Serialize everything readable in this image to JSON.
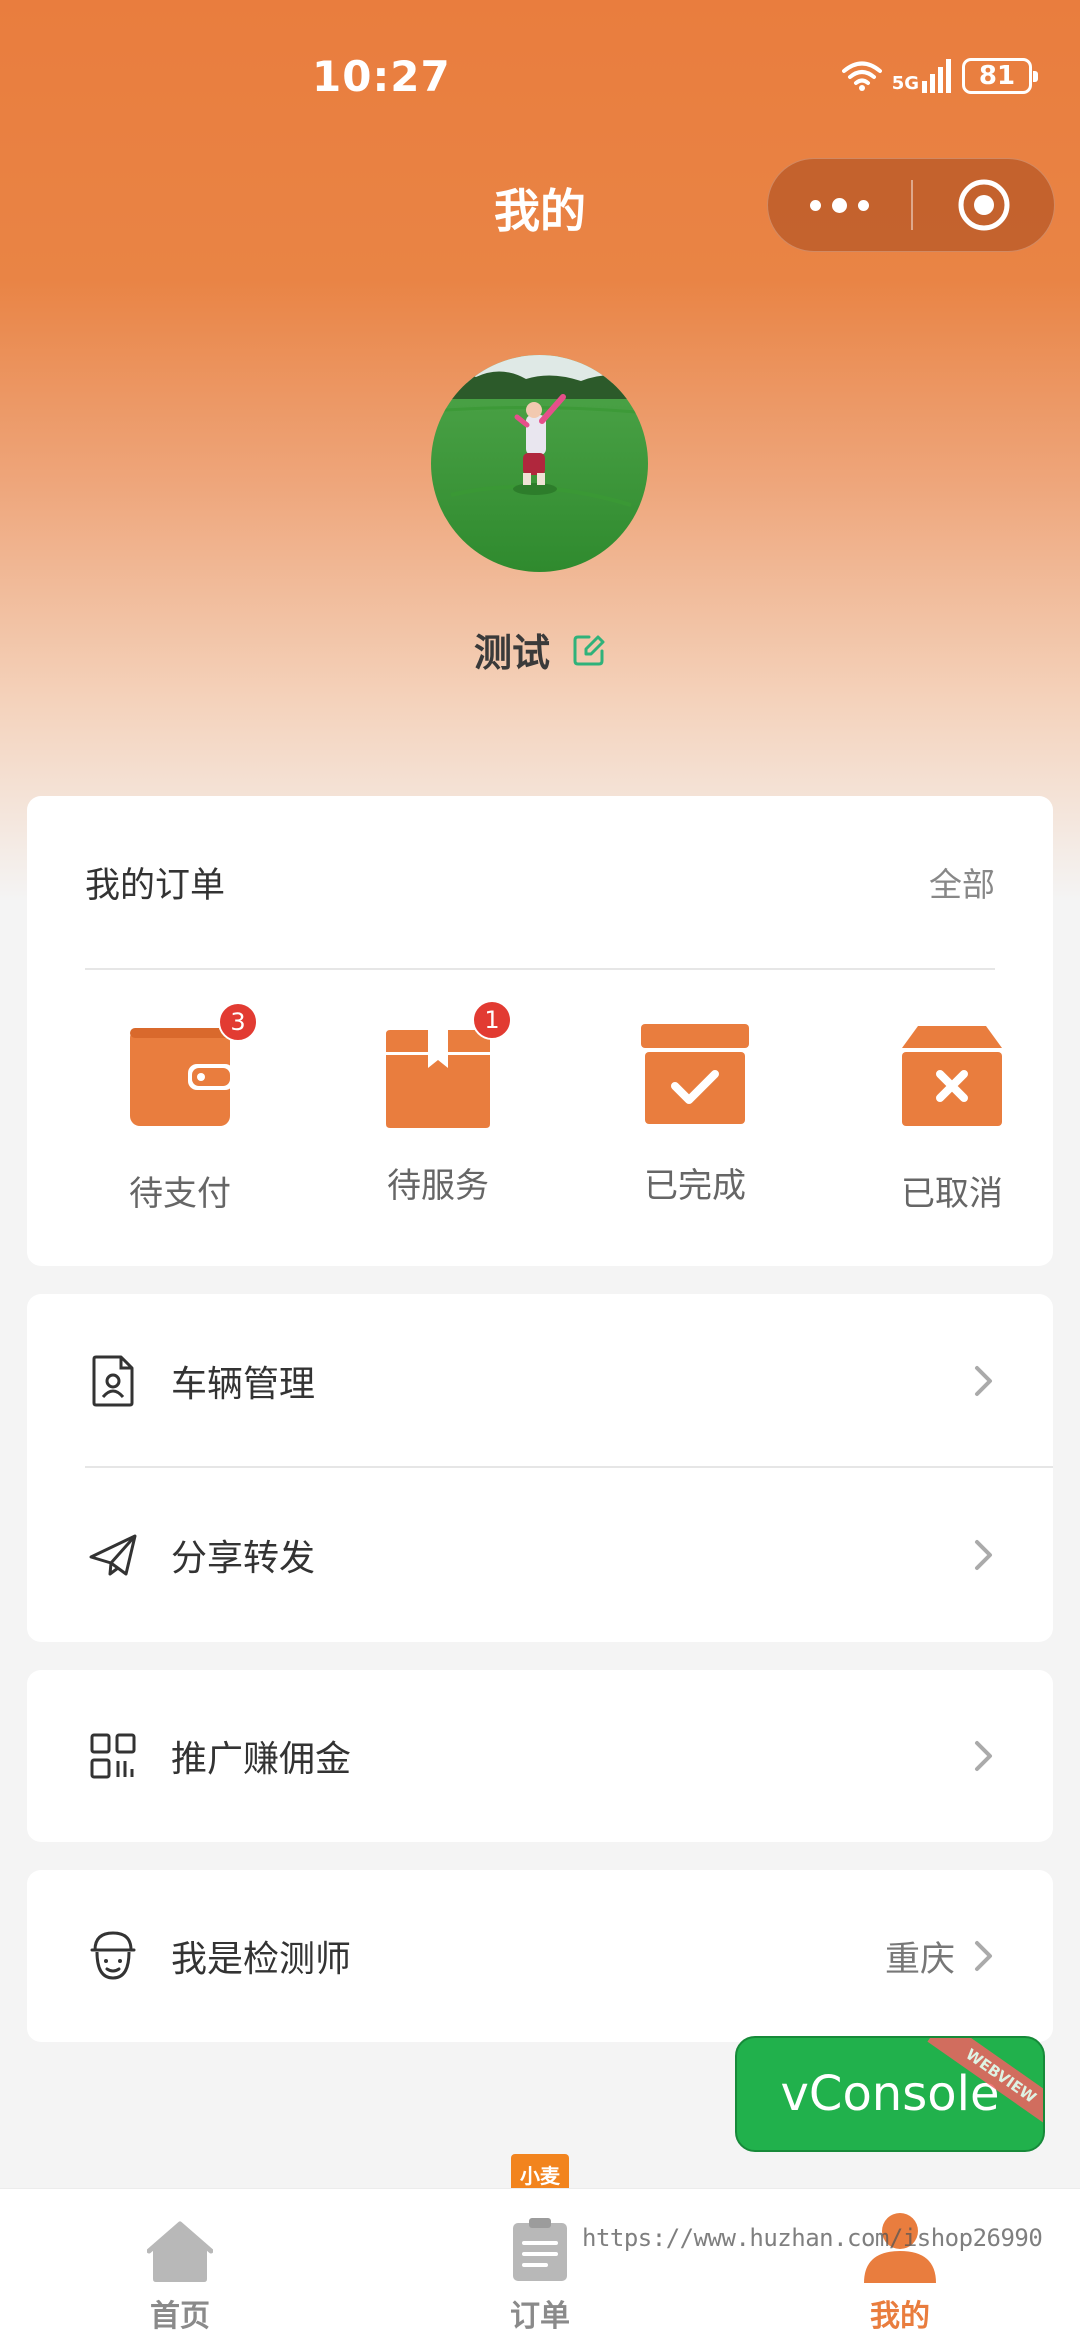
{
  "status_bar": {
    "time": "10:27",
    "network": "5G",
    "battery": "81"
  },
  "nav": {
    "title": "我的"
  },
  "profile": {
    "username": "测试"
  },
  "orders": {
    "title": "我的订单",
    "all_label": "全部",
    "items": [
      {
        "label": "待支付",
        "badge": "3",
        "icon": "wallet-icon"
      },
      {
        "label": "待服务",
        "badge": "1",
        "icon": "box-icon"
      },
      {
        "label": "已完成",
        "badge": "",
        "icon": "completed-icon"
      },
      {
        "label": "已取消",
        "badge": "",
        "icon": "cancelled-icon"
      }
    ]
  },
  "menu": [
    {
      "label": "车辆管理",
      "value": "",
      "icon": "document-icon"
    },
    {
      "label": "分享转发",
      "value": "",
      "icon": "paper-plane-icon"
    },
    {
      "label": "推广赚佣金",
      "value": "",
      "icon": "qrcode-icon"
    },
    {
      "label": "我是检测师",
      "value": "重庆",
      "icon": "inspector-icon"
    }
  ],
  "vconsole": {
    "label": "vConsole",
    "ribbon": "WEBVIEW"
  },
  "tabbar": {
    "items": [
      {
        "label": "首页",
        "icon": "home-icon",
        "active": false
      },
      {
        "label": "订单",
        "icon": "order-list-icon",
        "active": false
      },
      {
        "label": "我的",
        "icon": "user-icon",
        "active": true
      }
    ],
    "mini_tag": "小麦"
  },
  "watermark": "https://www.huzhan.com/ishop26990",
  "colors": {
    "accent": "#e97d3e",
    "badge": "#e23b32",
    "vconsole": "#21b14c",
    "edit_icon": "#2fb27a"
  }
}
